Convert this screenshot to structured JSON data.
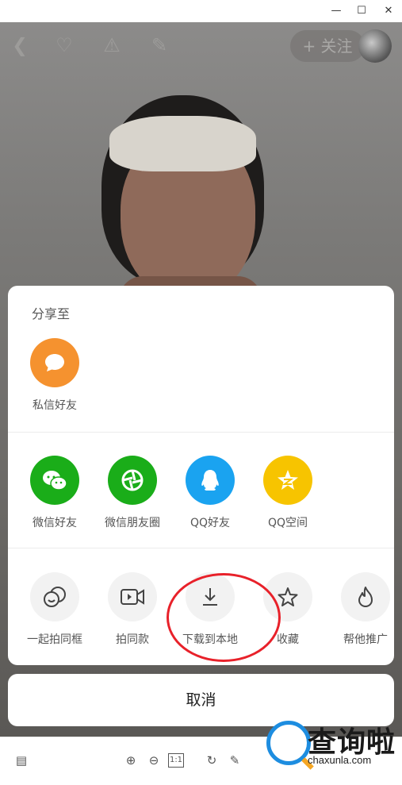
{
  "window": {
    "minimize": "—",
    "maximize": "☐",
    "close": "✕"
  },
  "video": {
    "follow_label": "+ 关注"
  },
  "share": {
    "title": "分享至",
    "row1": [
      {
        "label": "私信好友",
        "icon": "message-icon",
        "color": "#f5922f"
      }
    ],
    "row2": [
      {
        "label": "微信好友",
        "icon": "wechat-icon",
        "color": "#1aad19"
      },
      {
        "label": "微信朋友圈",
        "icon": "moments-icon",
        "color": "#1aad19"
      },
      {
        "label": "QQ好友",
        "icon": "qq-icon",
        "color": "#1aa3f0"
      },
      {
        "label": "QQ空间",
        "icon": "qzone-icon",
        "color": "#f7c400"
      }
    ],
    "row3": [
      {
        "label": "一起拍同框",
        "icon": "duet-icon"
      },
      {
        "label": "拍同款",
        "icon": "video-camera-icon"
      },
      {
        "label": "下载到本地",
        "icon": "download-icon"
      },
      {
        "label": "收藏",
        "icon": "star-icon"
      },
      {
        "label": "帮他推广",
        "icon": "flame-icon"
      }
    ],
    "cancel": "取消"
  },
  "watermark": {
    "text": "查询啦",
    "sub": "chaxunla.com"
  }
}
